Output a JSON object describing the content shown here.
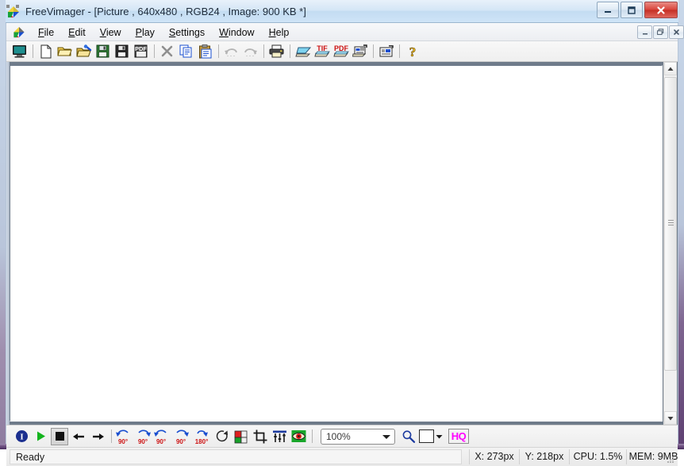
{
  "window": {
    "title": "FreeVimager - [Picture , 640x480 , RGB24 , Image: 900 KB *]",
    "app_icon": "freevimager-logo-icon",
    "controls": {
      "minimize": "minimize-icon",
      "maximize": "maximize-icon",
      "close": "close-icon"
    }
  },
  "menu": {
    "logo": "freevimager-logo-icon",
    "items": [
      {
        "label": "File",
        "accel": "F"
      },
      {
        "label": "Edit",
        "accel": "E"
      },
      {
        "label": "View",
        "accel": "V"
      },
      {
        "label": "Play",
        "accel": "P"
      },
      {
        "label": "Settings",
        "accel": "S"
      },
      {
        "label": "Window",
        "accel": "W"
      },
      {
        "label": "Help",
        "accel": "H"
      }
    ],
    "mdi_controls": {
      "minimize": "mdi-minimize-icon",
      "restore": "mdi-restore-icon",
      "close": "mdi-close-icon"
    }
  },
  "toolbar_top": {
    "buttons": [
      {
        "name": "fullscreen-monitor-icon",
        "title": "Full Screen",
        "enabled": true
      },
      {
        "name": "new-file-icon",
        "title": "New",
        "enabled": true
      },
      {
        "name": "open-folder-icon",
        "title": "Open",
        "enabled": true
      },
      {
        "name": "open-with-icon",
        "title": "Open With",
        "enabled": true
      },
      {
        "name": "save-icon",
        "title": "Save",
        "enabled": true
      },
      {
        "name": "save-as-icon",
        "title": "Save As",
        "enabled": true
      },
      {
        "name": "save-pdf-icon",
        "title": "Save as PDF",
        "enabled": true
      },
      {
        "name": "delete-icon",
        "title": "Delete",
        "enabled": true
      },
      {
        "name": "copy-icon",
        "title": "Copy",
        "enabled": true
      },
      {
        "name": "paste-icon",
        "title": "Paste",
        "enabled": true
      },
      {
        "name": "undo-icon",
        "title": "Undo",
        "enabled": false
      },
      {
        "name": "redo-icon",
        "title": "Redo",
        "enabled": false
      },
      {
        "name": "print-icon",
        "title": "Print",
        "enabled": true
      },
      {
        "name": "scanner-icon",
        "title": "Acquire",
        "enabled": true
      },
      {
        "name": "scan-tif-icon",
        "title": "Scan to TIF",
        "enabled": true
      },
      {
        "name": "scan-pdf-icon",
        "title": "Scan to PDF",
        "enabled": true
      },
      {
        "name": "scan-to-file-icon",
        "title": "Scan to File",
        "enabled": true
      },
      {
        "name": "batch-scan-icon",
        "title": "Batch",
        "enabled": true
      },
      {
        "name": "help-question-icon",
        "title": "Help",
        "enabled": true
      }
    ],
    "labels": {
      "tif": "TIF",
      "pdf": "PDF",
      "help": "?"
    }
  },
  "toolbar_bottom": {
    "buttons": [
      {
        "name": "info-icon",
        "title": "Info"
      },
      {
        "name": "play-icon",
        "title": "Play"
      },
      {
        "name": "stop-icon",
        "title": "Stop"
      },
      {
        "name": "previous-icon",
        "title": "Previous"
      },
      {
        "name": "next-icon",
        "title": "Next"
      },
      {
        "name": "rotate-left-90-icon",
        "title": "Rotate Left 90",
        "label": "90°"
      },
      {
        "name": "rotate-right-90-icon",
        "title": "Rotate Right 90",
        "label": "90°"
      },
      {
        "name": "rotate-left-lossless-icon",
        "title": "Lossless Rotate Left",
        "label": "90°"
      },
      {
        "name": "rotate-right-lossless-icon",
        "title": "Lossless Rotate Right",
        "label": "90°"
      },
      {
        "name": "rotate-180-icon",
        "title": "Rotate 180",
        "label": "180°"
      },
      {
        "name": "free-rotate-icon",
        "title": "Free Rotate"
      },
      {
        "name": "color-balance-icon",
        "title": "Color Balance"
      },
      {
        "name": "crop-icon",
        "title": "Crop"
      },
      {
        "name": "levels-icon",
        "title": "Levels"
      },
      {
        "name": "red-eye-icon",
        "title": "Red Eye Removal"
      }
    ],
    "zoom": {
      "value": "100%",
      "name": "zoom-combo",
      "magnifier": "magnifier-icon"
    },
    "background_color": "#ffffff",
    "hq": {
      "label": "HQ",
      "color": "#FF00FF"
    }
  },
  "status_bar": {
    "message": "Ready",
    "cells": [
      {
        "name": "status-x",
        "text": "X: 273px"
      },
      {
        "name": "status-y",
        "text": "Y: 218px"
      },
      {
        "name": "status-cpu",
        "text": "CPU: 1.5%"
      },
      {
        "name": "status-mem",
        "text": "MEM: 9MB"
      }
    ]
  },
  "canvas": {
    "background": "#ffffff",
    "scrollbar": {
      "orientation": "vertical",
      "position": "top"
    }
  }
}
